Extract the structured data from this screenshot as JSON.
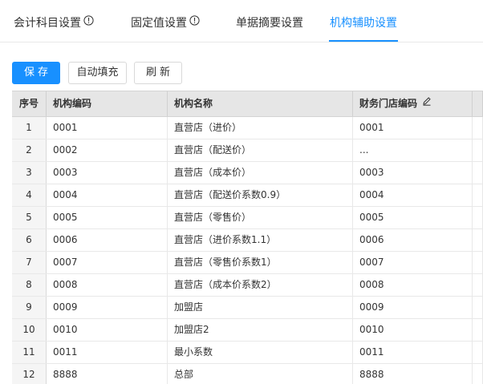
{
  "tabs": [
    {
      "label": "会计科目设置",
      "info": true,
      "active": false
    },
    {
      "label": "固定值设置",
      "info": true,
      "active": false
    },
    {
      "label": "单据摘要设置",
      "info": false,
      "active": false
    },
    {
      "label": "机构辅助设置",
      "info": false,
      "active": true
    }
  ],
  "toolbar": {
    "save_label": "保存",
    "autofill_label": "自动填充",
    "refresh_label": "刷新"
  },
  "table": {
    "columns": [
      "序号",
      "机构编码",
      "机构名称",
      "财务门店编码"
    ],
    "rows": [
      {
        "index": "1",
        "code": "0001",
        "name": "直营店（进价）",
        "fin_code": "0001"
      },
      {
        "index": "2",
        "code": "0002",
        "name": "直营店（配送价）",
        "fin_code": "..."
      },
      {
        "index": "3",
        "code": "0003",
        "name": "直营店（成本价）",
        "fin_code": "0003"
      },
      {
        "index": "4",
        "code": "0004",
        "name": "直营店（配送价系数0.9）",
        "fin_code": "0004"
      },
      {
        "index": "5",
        "code": "0005",
        "name": "直营店（零售价）",
        "fin_code": "0005"
      },
      {
        "index": "6",
        "code": "0006",
        "name": "直营店（进价系数1.1）",
        "fin_code": "0006"
      },
      {
        "index": "7",
        "code": "0007",
        "name": "直营店（零售价系数1）",
        "fin_code": "0007"
      },
      {
        "index": "8",
        "code": "0008",
        "name": "直营店（成本价系数2）",
        "fin_code": "0008"
      },
      {
        "index": "9",
        "code": "0009",
        "name": "加盟店",
        "fin_code": "0009"
      },
      {
        "index": "10",
        "code": "0010",
        "name": "加盟店2",
        "fin_code": "0010"
      },
      {
        "index": "11",
        "code": "0011",
        "name": "最小系数",
        "fin_code": "0011"
      },
      {
        "index": "12",
        "code": "8888",
        "name": "总部",
        "fin_code": "8888"
      }
    ]
  },
  "colors": {
    "accent": "#1890ff",
    "header_bg": "#e6e6e6",
    "border": "#e8e8e8"
  },
  "icons": {
    "tab_info": "info-circle-icon",
    "column_edit": "edit-pencil-icon"
  }
}
